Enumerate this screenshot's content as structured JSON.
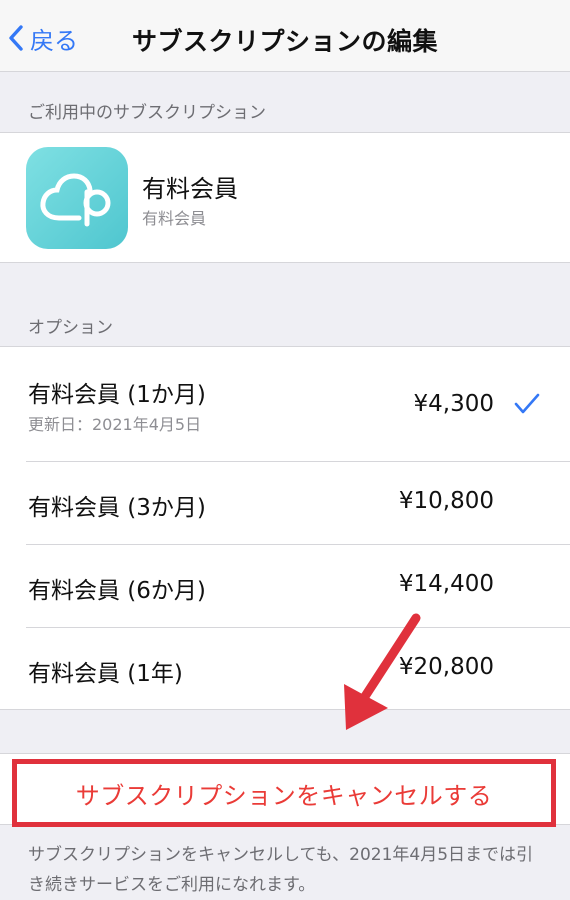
{
  "nav": {
    "back_label": "戻る",
    "title": "サブスクリプションの編集"
  },
  "current": {
    "header": "ご利用中のサブスクリプション",
    "app_name": "有料会員",
    "app_subtitle": "有料会員",
    "icon": "cloud-p-app-icon"
  },
  "options": {
    "header": "オプション",
    "items": [
      {
        "label": "有料会員 (1か月)",
        "renew": "更新日：2021年4月5日",
        "price": "¥4,300",
        "selected": true
      },
      {
        "label": "有料会員 (3か月)",
        "price": "¥10,800",
        "selected": false
      },
      {
        "label": "有料会員 (6か月)",
        "price": "¥14,400",
        "selected": false
      },
      {
        "label": "有料会員 (1年)",
        "price": "¥20,800",
        "selected": false
      }
    ]
  },
  "cancel": {
    "label": "サブスクリプションをキャンセルする"
  },
  "footer": {
    "note": "サブスクリプションをキャンセルしても、2021年4月5日までは引き続きサービスをご利用になれます。"
  },
  "colors": {
    "accent": "#3478f6",
    "destructive": "#ea3b37",
    "highlight": "#e0313c",
    "app_icon": "#5fd0d6"
  }
}
